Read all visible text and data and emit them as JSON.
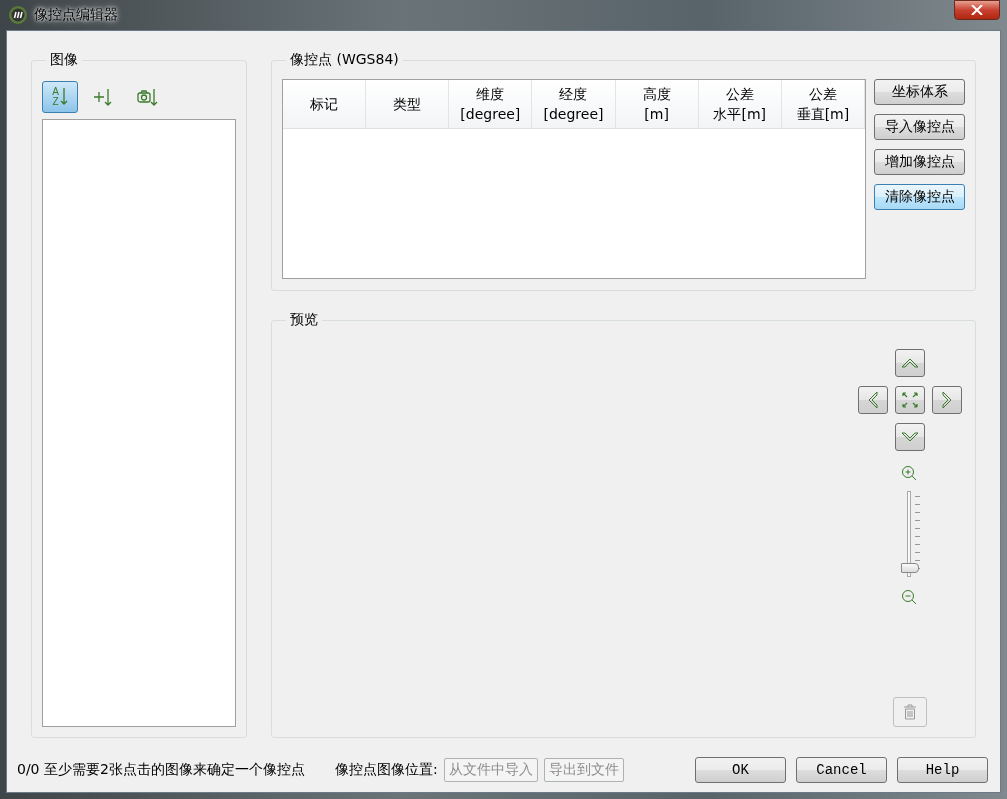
{
  "window": {
    "title": "像控点编辑器"
  },
  "images": {
    "title": "图像",
    "tools": [
      {
        "kind": "az",
        "selected": true,
        "top": "A",
        "bottom": "Z"
      },
      {
        "kind": "cross",
        "selected": false
      },
      {
        "kind": "camera",
        "selected": false
      }
    ]
  },
  "points": {
    "title": "像控点 (WGS84)",
    "columns": [
      {
        "label": "标记"
      },
      {
        "label": "类型"
      },
      {
        "label": "维度",
        "unit": "[degree]"
      },
      {
        "label": "经度",
        "unit": "[degree]"
      },
      {
        "label": "高度",
        "unit": "[m]"
      },
      {
        "label": "公差",
        "unit": "水平[m]"
      },
      {
        "label": "公差",
        "unit": "垂直[m]"
      }
    ],
    "buttons": [
      {
        "label": "坐标体系",
        "focused": false
      },
      {
        "label": "导入像控点",
        "focused": false
      },
      {
        "label": "增加像控点",
        "focused": false
      },
      {
        "label": "清除像控点",
        "focused": true
      }
    ]
  },
  "preview": {
    "title": "预览",
    "zoom": {
      "level": 0
    },
    "delete": {
      "disabled": true
    }
  },
  "status": {
    "text": "0/0 至少需要2张点击的图像来确定一个像控点",
    "location_label": "像控点图像位置:",
    "file_buttons": [
      {
        "label": "从文件中导入",
        "disabled": true
      },
      {
        "label": "导出到文件",
        "disabled": true
      }
    ],
    "buttons": [
      "OK",
      "Cancel",
      "Help"
    ]
  }
}
